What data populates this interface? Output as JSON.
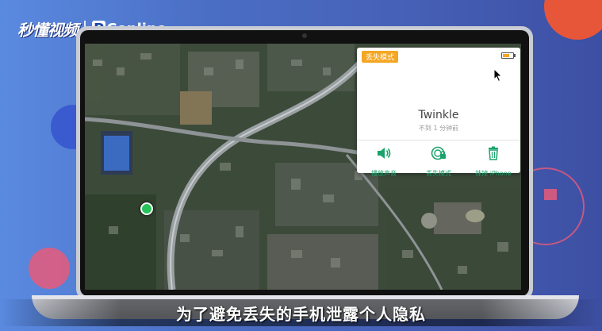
{
  "branding": {
    "video_brand": "秒懂视频",
    "site_brand_p": "P",
    "site_brand_rest": "Conline"
  },
  "find_my_panel": {
    "mode_badge": "丢失模式",
    "device_name": "Twinkle",
    "last_seen": "不到 1 分钟前",
    "battery_level": 0.7,
    "actions": [
      {
        "label": "播放声音",
        "icon": "speaker-icon"
      },
      {
        "label": "丢失模式",
        "icon": "lost-mode-icon"
      },
      {
        "label": "抹掉 iPhone",
        "icon": "trash-icon"
      }
    ],
    "accent_color": "#1aa36b",
    "badge_color": "#f5a623"
  },
  "map": {
    "type": "satellite",
    "pin_color": "#27c25a"
  },
  "subtitle": "为了避免丢失的手机泄露个人隐私"
}
